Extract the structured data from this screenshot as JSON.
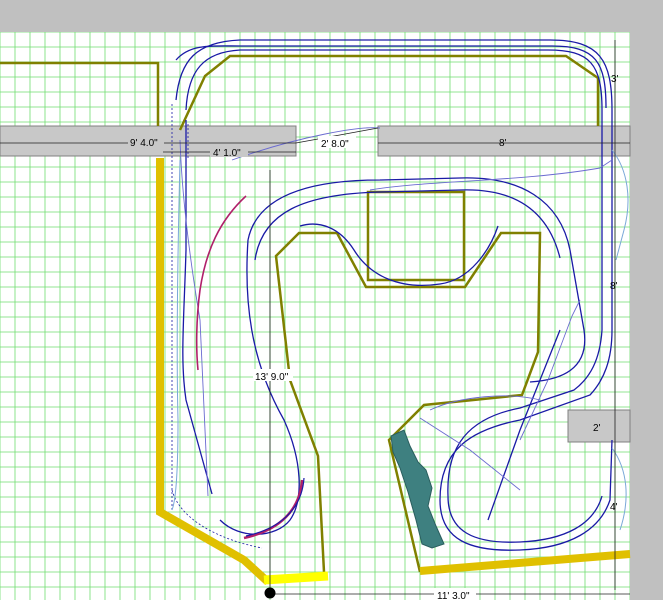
{
  "plan": {
    "dimensions": {
      "upper_wall_length": "9' 4.0\"",
      "upper_inner_span": "4' 1.0\"",
      "aisle_gap": "2' 8.0\"",
      "right_shelf_length": "8'",
      "left_depth": "13' 9.0\"",
      "right_top_depth": "3'",
      "right_middle_depth": "8'",
      "right_shelf_small": "2'",
      "right_bottom_depth": "4'",
      "bottom_length": "11' 3.0\""
    },
    "colors": {
      "background": "#ffffff",
      "grid": "#6fdd6f",
      "outer_gray": "#c0c0c0",
      "wall_fill": "#c8c8c8",
      "benchwork": "#808000",
      "fascia": "#e0c000",
      "track": "#1a1aa6",
      "track_alt": "#6a6ad0",
      "curve_highlight": "#b0206a",
      "water": "#3e8080",
      "dimension_line": "#202020"
    }
  }
}
